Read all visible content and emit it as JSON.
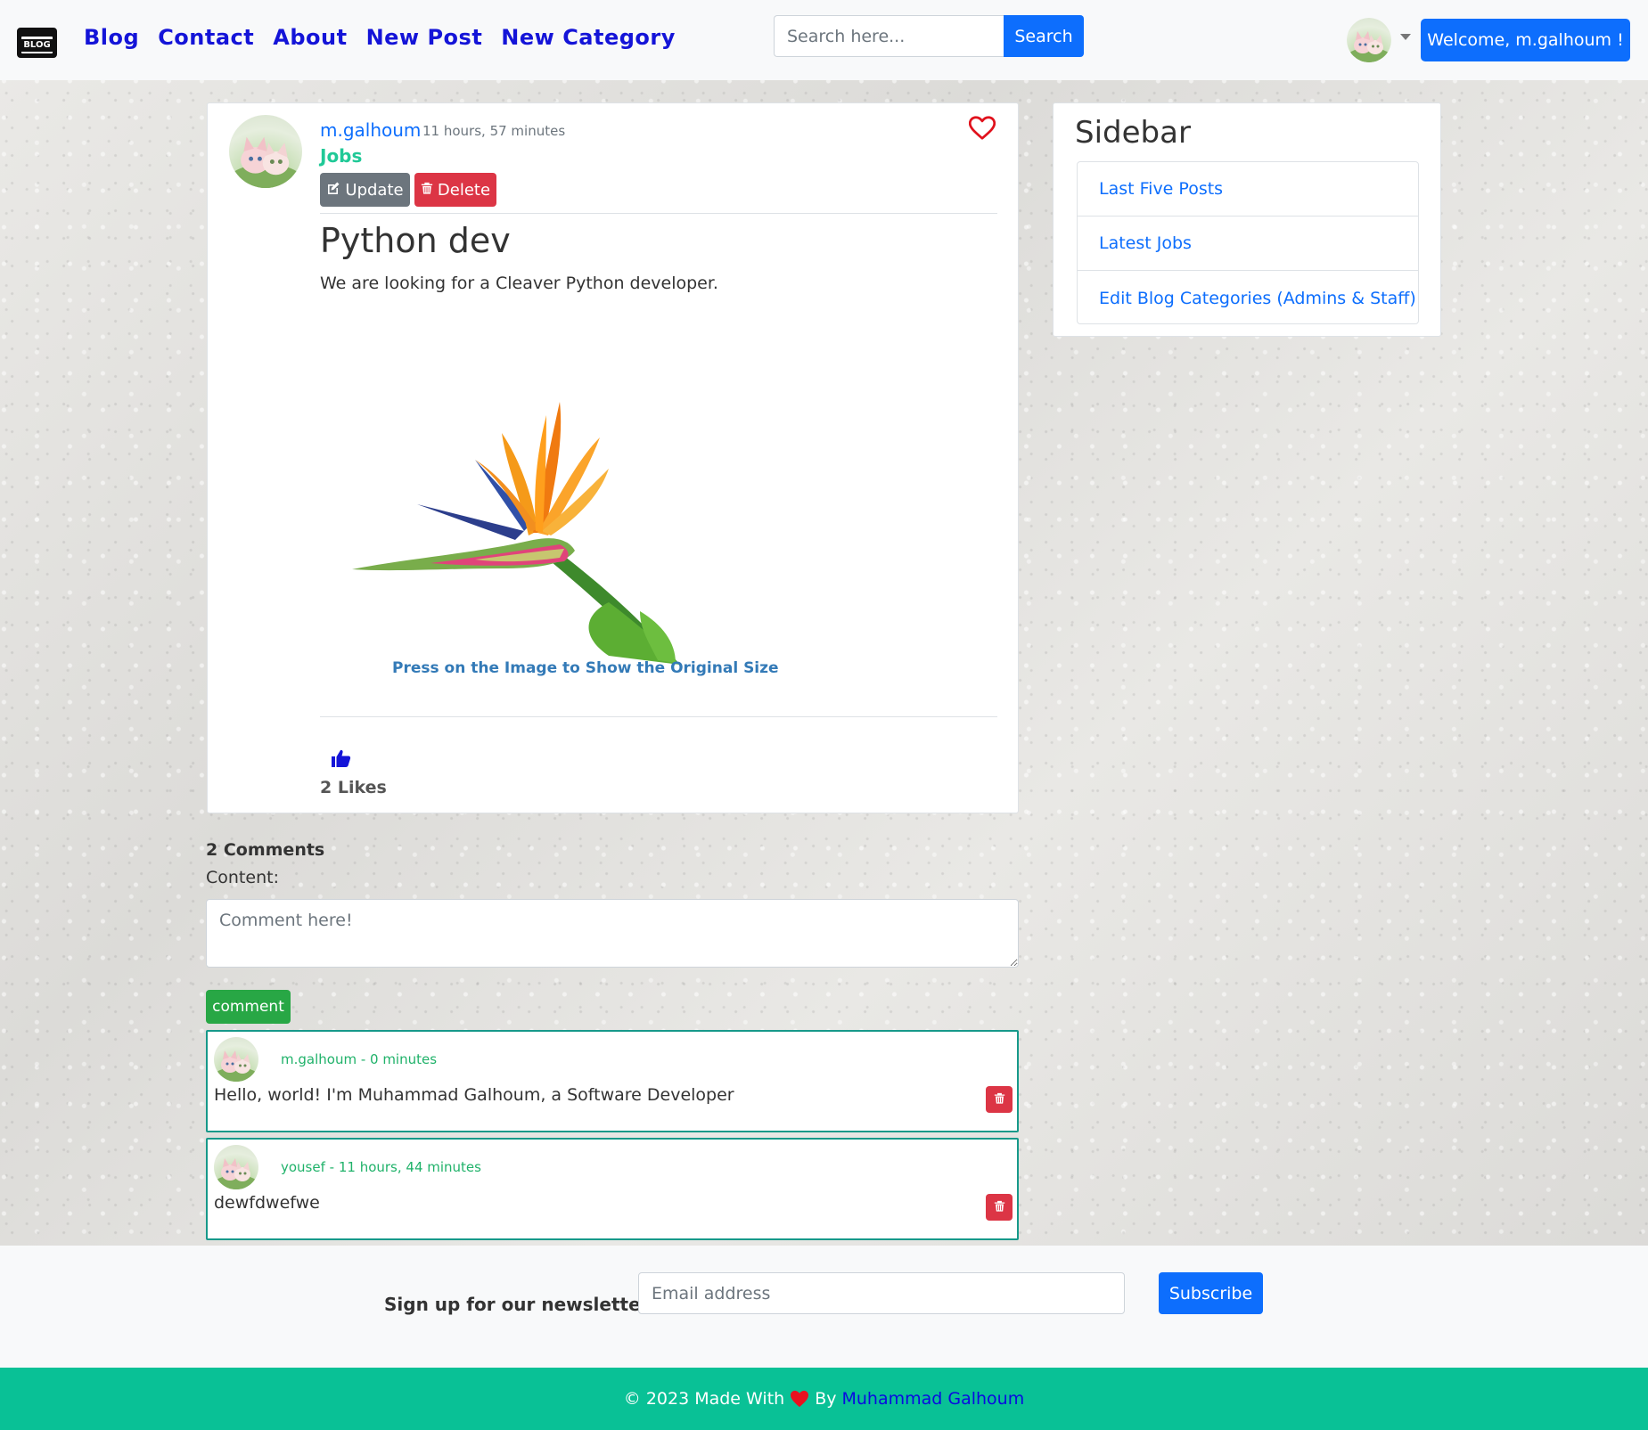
{
  "navbar": {
    "logo_text": "BLOG",
    "links": [
      "Blog",
      "Contact",
      "About",
      "New Post",
      "New Category"
    ],
    "search_placeholder": "Search here...",
    "search_button": "Search",
    "welcome_button": "Welcome, m.galhoum !"
  },
  "post": {
    "author": "m.galhoum",
    "time": "11 hours, 57 minutes",
    "category": "Jobs",
    "update_label": "Update",
    "delete_label": "Delete",
    "title": "Python dev",
    "body": "We are looking for a Cleaver Python developer.",
    "image_caption": "Press on the Image to Show the Original Size",
    "likes": "2 Likes"
  },
  "sidebar": {
    "title": "Sidebar",
    "items": [
      "Last Five Posts",
      "Latest Jobs",
      "Edit Blog Categories (Admins & Staff)"
    ]
  },
  "comments": {
    "count": "2 Comments",
    "content_label": "Content:",
    "textarea_placeholder": "Comment here!",
    "comment_button": "comment",
    "items": [
      {
        "meta": "m.galhoum - 0 minutes",
        "text": "Hello, world! I'm Muhammad Galhoum, a Software Developer"
      },
      {
        "meta": "yousef - 11 hours, 44 minutes",
        "text": "dewfdwefwe"
      }
    ]
  },
  "newsletter": {
    "label": "Sign up for our newsletter",
    "email_placeholder": "Email address",
    "subscribe_button": "Subscribe"
  },
  "footer": {
    "prefix": "© 2023 Made With",
    "by": "By",
    "author_link": "Muhammad Galhoum"
  },
  "colors": {
    "primary": "#0d6efd",
    "nav_link": "#1414d8",
    "category": "#20c997",
    "danger": "#dc3545",
    "success": "#28a745",
    "footer": "#09c196",
    "comment_border": "#17998a"
  },
  "icons": [
    "blog-logo",
    "avatar",
    "caret-down-icon",
    "heart-icon",
    "edit-icon",
    "trash-icon",
    "thumbs-up-icon",
    "bird-of-paradise-flower"
  ]
}
